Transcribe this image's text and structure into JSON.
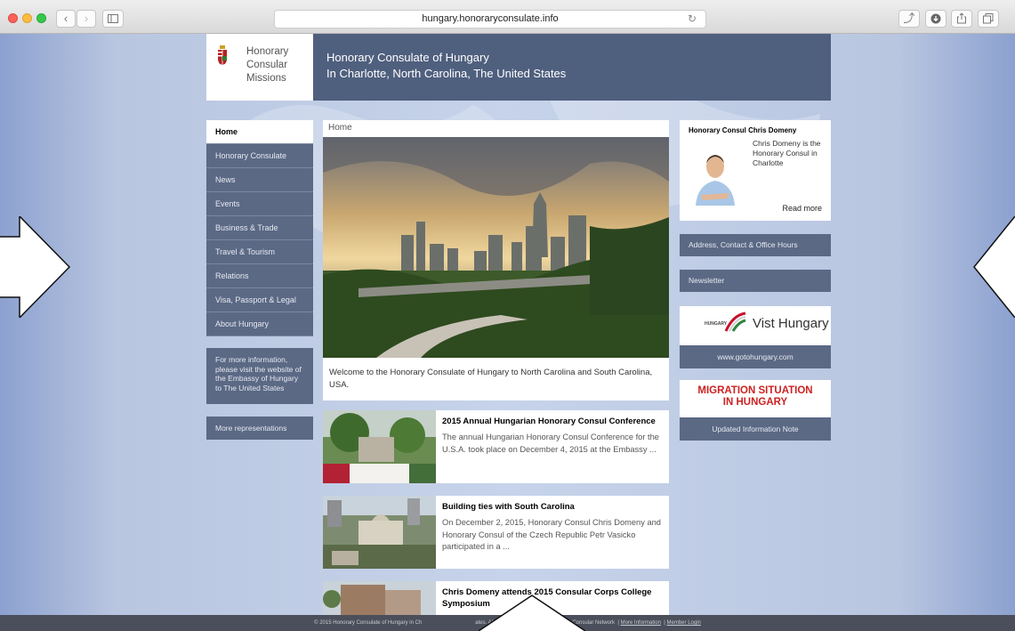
{
  "browser": {
    "url": "hungary.honoraryconsulate.info"
  },
  "logo": {
    "line1": "Honorary",
    "line2": "Consular",
    "line3": "Missions"
  },
  "header": {
    "title": "Honorary Consulate of Hungary",
    "subtitle": "In Charlotte, North Carolina, The United States"
  },
  "nav": {
    "items": [
      {
        "label": "Home"
      },
      {
        "label": "Honorary Consulate"
      },
      {
        "label": "News"
      },
      {
        "label": "Events"
      },
      {
        "label": "Business & Trade"
      },
      {
        "label": "Travel & Tourism"
      },
      {
        "label": "Relations"
      },
      {
        "label": "Visa, Passport & Legal"
      },
      {
        "label": "About Hungary"
      }
    ],
    "info": "For more information, please visit the website of the Embassy of Hungary to The United States",
    "more": "More representations"
  },
  "main": {
    "breadcrumb": "Home",
    "welcome": "Welcome to the Honorary Consulate of Hungary to North Carolina and South Carolina, USA."
  },
  "articles": [
    {
      "title": "2015 Annual Hungarian Honorary Consul Conference",
      "excerpt": "The annual Hungarian Honorary Consul Conference for the U.S.A. took place on December 4, 2015 at the Embassy ..."
    },
    {
      "title": "Building ties with South Carolina",
      "excerpt": "On December 2, 2015, Honorary Consul Chris Domeny and Honorary Consul of the Czech Republic Petr Vasicko participated in a ..."
    },
    {
      "title": "Chris Domeny attends 2015 Consular Corps College Symposium",
      "excerpt": ""
    }
  ],
  "sidebar": {
    "consul_title": "Honorary Consul Chris Domeny",
    "consul_text": "Chris Domeny is the Honorary Consul in Charlotte",
    "read_more": "Read more",
    "address": "Address, Contact & Office Hours",
    "newsletter": "Newsletter",
    "visit_brand": "HUNGARY",
    "visit_text": "Vist Hungary",
    "visit_url": "www.gotohungary.com",
    "migration_line1": "MIGRATION SITUATION",
    "migration_line2": "IN HUNGARY",
    "migration_note": "Updated Information Note"
  },
  "footer": {
    "text": "© 2015 Honorary Consulate of Hungary in Ch",
    "text_after": "ates. All rights reserved. Powered by the Consular Network",
    "link1": "More Information",
    "link2": "Member Login"
  },
  "colors": {
    "header": "#4f5f7e",
    "nav": "#5b6985",
    "migration": "#cc2222"
  }
}
